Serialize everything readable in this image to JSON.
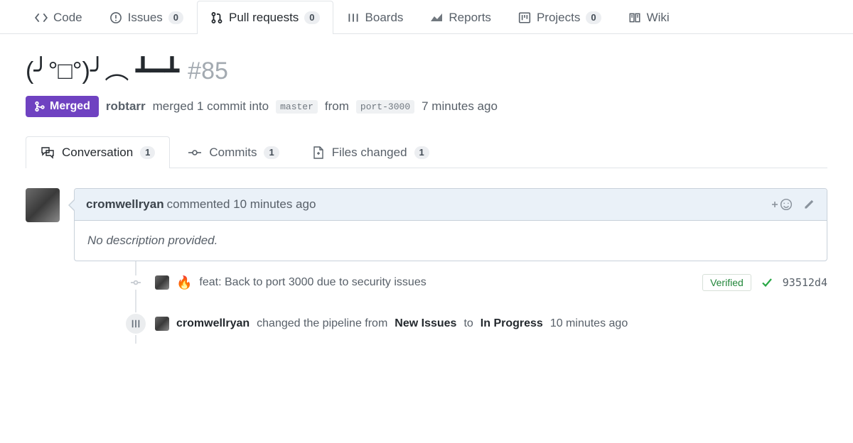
{
  "repoTabs": {
    "code": "Code",
    "issues": "Issues",
    "issuesCount": "0",
    "pulls": "Pull requests",
    "pullsCount": "0",
    "boards": "Boards",
    "reports": "Reports",
    "projects": "Projects",
    "projectsCount": "0",
    "wiki": "Wiki"
  },
  "title": {
    "text": "(╯°□°)╯︵ ┻━┻",
    "number": "#85"
  },
  "meta": {
    "stateLabel": "Merged",
    "author": "robtarr",
    "mergedText1": "merged 1 commit into",
    "baseBranch": "master",
    "fromText": "from",
    "headBranch": "port-3000",
    "time": "7 minutes ago"
  },
  "prTabs": {
    "conversation": "Conversation",
    "conversationCount": "1",
    "commits": "Commits",
    "commitsCount": "1",
    "files": "Files changed",
    "filesCount": "1"
  },
  "comment": {
    "author": "cromwellryan",
    "verb": "commented",
    "time": "10 minutes ago",
    "body": "No description provided."
  },
  "commit": {
    "emoji": "🔥",
    "message": "feat: Back to port 3000 due to security issues",
    "verified": "Verified",
    "sha": "93512d4"
  },
  "pipelineEvent": {
    "author": "cromwellryan",
    "text1": "changed the pipeline from",
    "from": "New Issues",
    "text2": "to",
    "to": "In Progress",
    "time": "10 minutes ago"
  }
}
